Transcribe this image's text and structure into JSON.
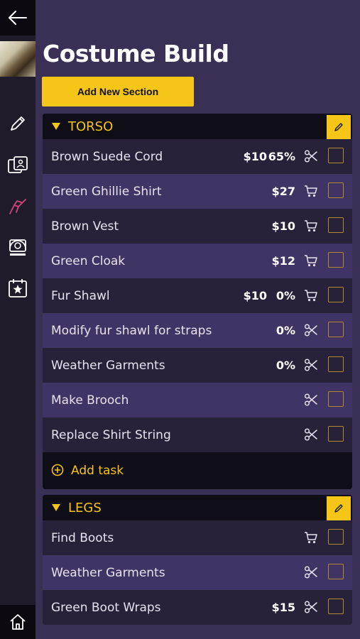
{
  "page": {
    "title": "Costume Build",
    "add_section_label": "Add New Section"
  },
  "sidebar": {
    "items": [
      {
        "icon": "back-arrow-icon"
      },
      {
        "icon": "avatar"
      },
      {
        "icon": "pencil-icon"
      },
      {
        "icon": "reference-images-icon"
      },
      {
        "icon": "glue-gun-icon"
      },
      {
        "icon": "camera-icon"
      },
      {
        "icon": "calendar-star-icon"
      },
      {
        "icon": "home-icon"
      }
    ]
  },
  "sections": [
    {
      "title": "TORSO",
      "add_task_label": "Add task",
      "rows": [
        {
          "label": "Brown Suede Cord",
          "cost": "$10",
          "pct": "65%",
          "tool": "scissors"
        },
        {
          "label": "Green Ghillie Shirt",
          "cost": "$27",
          "pct": "",
          "tool": "cart"
        },
        {
          "label": "Brown Vest",
          "cost": "$10",
          "pct": "",
          "tool": "cart"
        },
        {
          "label": "Green Cloak",
          "cost": "$12",
          "pct": "",
          "tool": "cart"
        },
        {
          "label": "Fur Shawl",
          "cost": "$10",
          "pct": "0%",
          "tool": "cart"
        },
        {
          "label": "Modify fur shawl for straps",
          "cost": "",
          "pct": "0%",
          "tool": "scissors"
        },
        {
          "label": "Weather Garments",
          "cost": "",
          "pct": "0%",
          "tool": "scissors"
        },
        {
          "label": "Make Brooch",
          "cost": "",
          "pct": "",
          "tool": "scissors"
        },
        {
          "label": "Replace Shirt String",
          "cost": "",
          "pct": "",
          "tool": "scissors"
        }
      ]
    },
    {
      "title": "LEGS",
      "rows": [
        {
          "label": "Find Boots",
          "cost": "",
          "pct": "",
          "tool": "cart"
        },
        {
          "label": "Weather Garments",
          "cost": "",
          "pct": "",
          "tool": "scissors"
        },
        {
          "label": "Green Boot Wraps",
          "cost": "$15",
          "pct": "",
          "tool": "scissors"
        }
      ]
    }
  ],
  "colors": {
    "background": "#3a2f55",
    "accent": "#f5c518",
    "sidebar": "#1f1b2b",
    "row_dark": "#27223a",
    "row_light": "#3f3463"
  }
}
